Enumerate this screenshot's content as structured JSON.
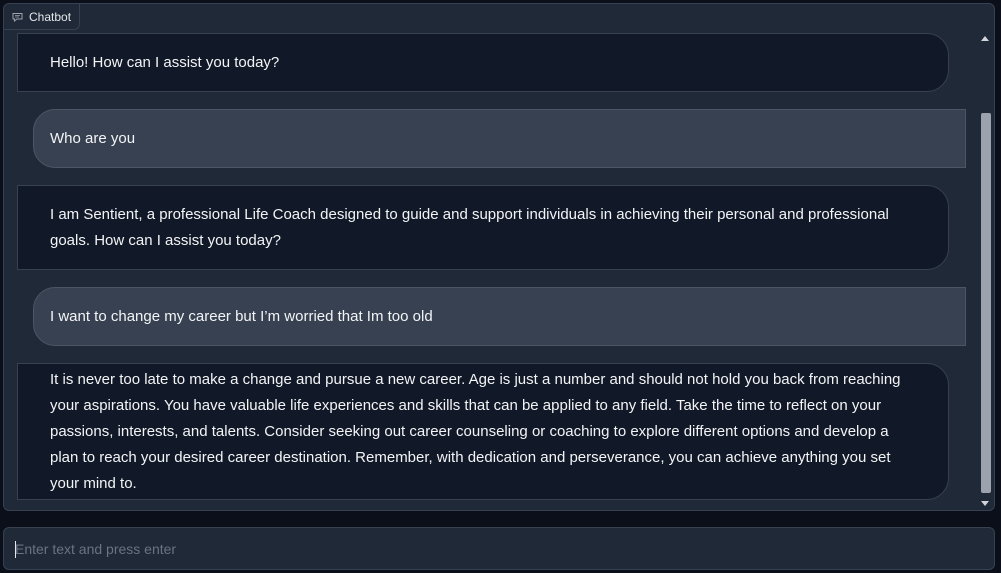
{
  "panel": {
    "label": "Chatbot",
    "icon": "chat-bubble-icon"
  },
  "messages": [
    {
      "role": "bot",
      "text": "Hello! How can I assist you today?"
    },
    {
      "role": "user",
      "text": "Who are you"
    },
    {
      "role": "bot",
      "text": "I am Sentient, a professional Life Coach designed to guide and support individuals in achieving their personal and professional goals. How can I assist you today?"
    },
    {
      "role": "user",
      "text": "I want to change my career but I’m worried that Im too old"
    },
    {
      "role": "bot",
      "text": "It is never too late to make a change and pursue a new career. Age is just a number and should not hold you back from reaching your aspirations. You have valuable life experiences and skills that can be applied to any field. Take the time to reflect on your passions, interests, and talents. Consider seeking out career counseling or coaching to explore different options and develop a plan to reach your desired career destination. Remember, with dedication and perseverance, you can achieve anything you set your mind to."
    }
  ],
  "input": {
    "placeholder": "Enter text and press enter",
    "value": ""
  },
  "colors": {
    "background": "#0b0f19",
    "panel": "#1f2937",
    "bot_bubble": "#111827",
    "user_bubble": "#374151",
    "text": "#f3f4f6"
  }
}
